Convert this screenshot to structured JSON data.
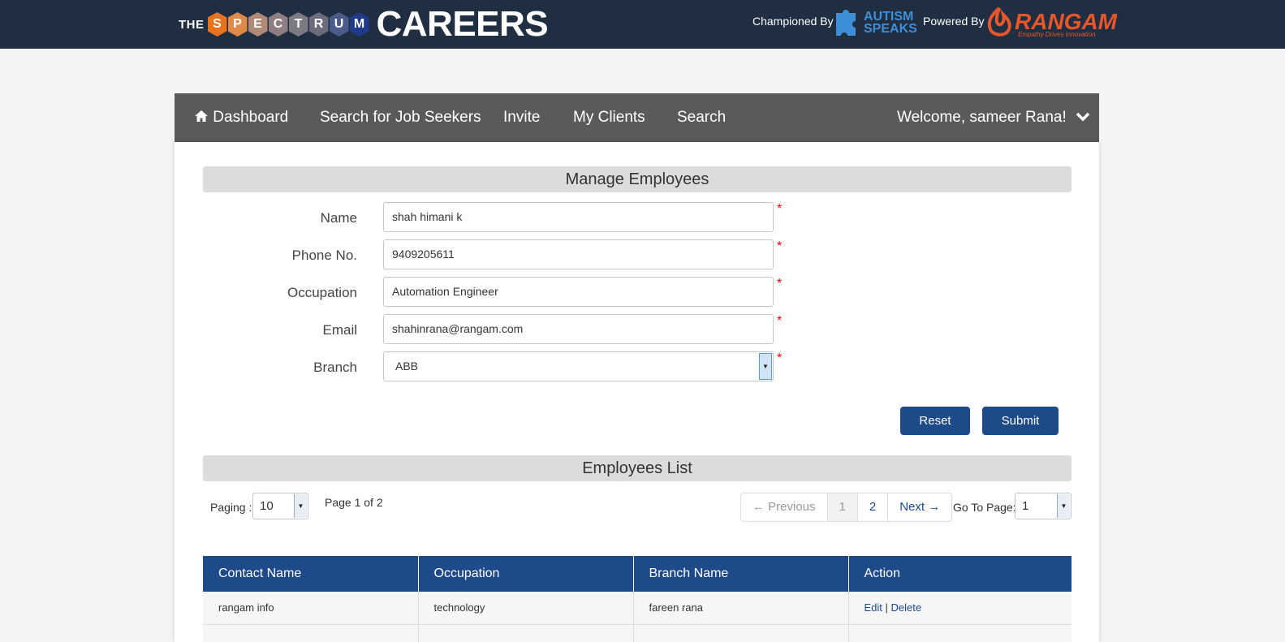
{
  "header": {
    "logo_the": "THE",
    "logo_letters": [
      "S",
      "P",
      "E",
      "C",
      "T",
      "R",
      "U",
      "M"
    ],
    "logo_careers": "CAREERS",
    "championed_by": "Championed By",
    "autism_speaks": "AUTISM SPEAKS",
    "powered_by": "Powered By",
    "rangam": "RANGAM",
    "rangam_tagline": "Empathy Drives Innovation"
  },
  "nav": {
    "items": [
      {
        "label": "Dashboard",
        "icon": "home-icon"
      },
      {
        "label": "Search for Job Seekers"
      },
      {
        "label": "Invite"
      },
      {
        "label": "My Clients"
      },
      {
        "label": "Search"
      }
    ],
    "welcome": "Welcome, sameer Rana!"
  },
  "form": {
    "title": "Manage Employees",
    "fields": [
      {
        "label": "Name",
        "value": "shah himani k"
      },
      {
        "label": "Phone No.",
        "value": "9409205611"
      },
      {
        "label": "Occupation",
        "value": "Automation Engineer"
      },
      {
        "label": "Email",
        "value": "shahinrana@rangam.com"
      },
      {
        "label": "Branch",
        "value": "ABB"
      }
    ],
    "required_mark": "*",
    "reset_label": "Reset",
    "submit_label": "Submit"
  },
  "list": {
    "title": "Employees List",
    "paging_label": "Paging :",
    "paging_value": "10",
    "page_info": "Page 1 of 2",
    "pager": {
      "previous": "← Previous",
      "pages": [
        "1",
        "2"
      ],
      "next": "Next →"
    },
    "goto_label": "Go To Page:",
    "goto_value": "1",
    "columns": [
      "Contact Name",
      "Occupation",
      "Branch Name",
      "Action"
    ],
    "rows": [
      {
        "contact": "rangam info",
        "occupation": "technology",
        "branch": "fareen rana",
        "edit": "Edit",
        "sep": "|",
        "delete": "Delete"
      }
    ]
  },
  "colors": {
    "header_bg": "#1f2e40",
    "nav_bg": "#5a5a5a",
    "accent": "#1f4a8a",
    "hex_colors": [
      "#e8731e",
      "#e08a4a",
      "#b08a78",
      "#8e7e82",
      "#7d7a84",
      "#6c6c7c",
      "#4a5a8a",
      "#1f3a8a"
    ]
  }
}
